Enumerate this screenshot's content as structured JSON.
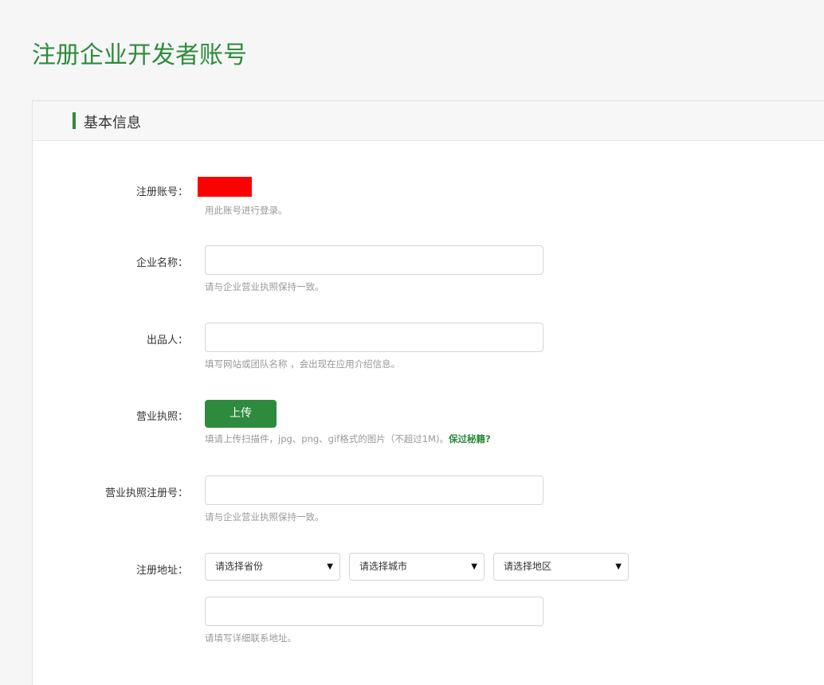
{
  "page": {
    "title": "注册企业开发者账号"
  },
  "section": {
    "title": "基本信息"
  },
  "form": {
    "account": {
      "label": "注册账号：",
      "hint": "用此账号进行登录。"
    },
    "company_name": {
      "label": "企业名称：",
      "value": "",
      "hint": "请与企业营业执照保持一致。"
    },
    "producer": {
      "label": "出品人：",
      "value": "",
      "hint": "填写网站或团队名称 ，会出现在应用介绍信息。"
    },
    "license": {
      "label": "营业执照：",
      "upload_label": "上传",
      "hint": "填请上传扫描件，jpg、png、gif格式的图片（不超过1M)。",
      "hint_link": "保过秘籍?"
    },
    "license_number": {
      "label": "营业执照注册号：",
      "value": "",
      "hint": "请与企业营业执照保持一致。"
    },
    "address": {
      "label": "注册地址：",
      "province": "请选择省份",
      "city": "请选择城市",
      "district": "请选择地区",
      "detail_value": "",
      "hint": "请填写详细联系地址。"
    }
  },
  "icons": {
    "dropdown": "caret-down-icon"
  },
  "colors": {
    "accent": "#2e8b3e",
    "mask": "#ff0000"
  }
}
